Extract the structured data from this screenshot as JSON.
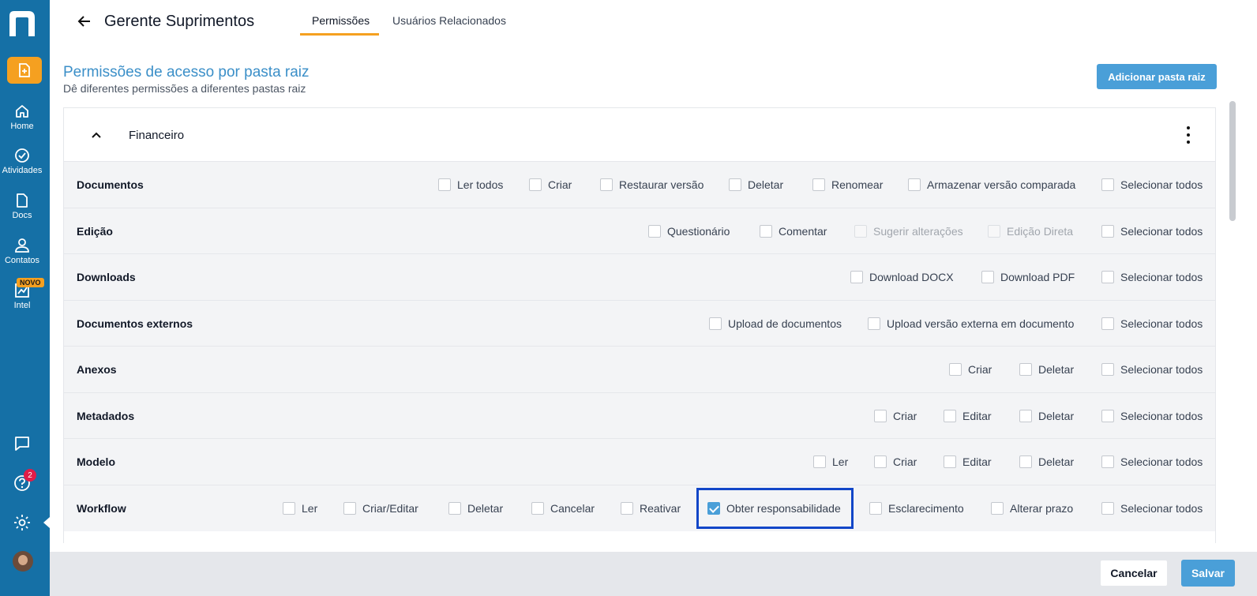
{
  "sidebar": {
    "items": [
      {
        "label": "Home"
      },
      {
        "label": "Atividades"
      },
      {
        "label": "Docs"
      },
      {
        "label": "Contatos"
      },
      {
        "label": "Intel",
        "badge": "NOVO"
      }
    ],
    "help_badge": "2"
  },
  "header": {
    "title": "Gerente Suprimentos",
    "tabs": [
      {
        "label": "Permissões",
        "active": true
      },
      {
        "label": "Usuários Relacionados",
        "active": false
      }
    ]
  },
  "section": {
    "title": "Permissões de acesso por pasta raiz",
    "subtitle": "Dê diferentes permissões a diferentes pastas raiz",
    "add_button": "Adicionar pasta raiz"
  },
  "folder": {
    "name": "Financeiro",
    "rows": [
      {
        "label": "Documentos",
        "options": [
          {
            "label": "Ler todos",
            "checked": false,
            "disabled": false
          },
          {
            "label": "Criar",
            "checked": false,
            "disabled": false
          },
          {
            "label": "Restaurar versão",
            "checked": false,
            "disabled": false
          },
          {
            "label": "Deletar",
            "checked": false,
            "disabled": false
          },
          {
            "label": "Renomear",
            "checked": false,
            "disabled": false
          },
          {
            "label": "Armazenar versão comparada",
            "checked": false,
            "disabled": false
          },
          {
            "label": "Selecionar todos",
            "checked": false,
            "disabled": false
          }
        ]
      },
      {
        "label": "Edição",
        "options": [
          {
            "label": "Questionário",
            "checked": false,
            "disabled": false
          },
          {
            "label": "Comentar",
            "checked": false,
            "disabled": false
          },
          {
            "label": "Sugerir alterações",
            "checked": false,
            "disabled": true
          },
          {
            "label": "Edição Direta",
            "checked": false,
            "disabled": true
          },
          {
            "label": "Selecionar todos",
            "checked": false,
            "disabled": false
          }
        ]
      },
      {
        "label": "Downloads",
        "options": [
          {
            "label": "Download DOCX",
            "checked": false,
            "disabled": false
          },
          {
            "label": "Download PDF",
            "checked": false,
            "disabled": false
          },
          {
            "label": "Selecionar todos",
            "checked": false,
            "disabled": false
          }
        ]
      },
      {
        "label": "Documentos externos",
        "options": [
          {
            "label": "Upload de documentos",
            "checked": false,
            "disabled": false
          },
          {
            "label": "Upload versão externa em documento",
            "checked": false,
            "disabled": false
          },
          {
            "label": "Selecionar todos",
            "checked": false,
            "disabled": false
          }
        ]
      },
      {
        "label": "Anexos",
        "options": [
          {
            "label": "Criar",
            "checked": false,
            "disabled": false
          },
          {
            "label": "Deletar",
            "checked": false,
            "disabled": false
          },
          {
            "label": "Selecionar todos",
            "checked": false,
            "disabled": false
          }
        ]
      },
      {
        "label": "Metadados",
        "options": [
          {
            "label": "Criar",
            "checked": false,
            "disabled": false
          },
          {
            "label": "Editar",
            "checked": false,
            "disabled": false
          },
          {
            "label": "Deletar",
            "checked": false,
            "disabled": false
          },
          {
            "label": "Selecionar todos",
            "checked": false,
            "disabled": false
          }
        ]
      },
      {
        "label": "Modelo",
        "options": [
          {
            "label": "Ler",
            "checked": false,
            "disabled": false
          },
          {
            "label": "Criar",
            "checked": false,
            "disabled": false
          },
          {
            "label": "Editar",
            "checked": false,
            "disabled": false
          },
          {
            "label": "Deletar",
            "checked": false,
            "disabled": false
          },
          {
            "label": "Selecionar todos",
            "checked": false,
            "disabled": false
          }
        ]
      },
      {
        "label": "Workflow",
        "options": [
          {
            "label": "Ler",
            "checked": false,
            "disabled": false
          },
          {
            "label": "Criar/Editar",
            "checked": false,
            "disabled": false
          },
          {
            "label": "Deletar",
            "checked": false,
            "disabled": false
          },
          {
            "label": "Cancelar",
            "checked": false,
            "disabled": false
          },
          {
            "label": "Reativar",
            "checked": false,
            "disabled": false
          },
          {
            "label": "Obter responsabilidade",
            "checked": true,
            "disabled": false
          },
          {
            "label": "Esclarecimento",
            "checked": false,
            "disabled": false
          },
          {
            "label": "Alterar prazo",
            "checked": false,
            "disabled": false
          },
          {
            "label": "Selecionar todos",
            "checked": false,
            "disabled": false
          }
        ]
      }
    ]
  },
  "footer": {
    "cancel_label": "Cancelar",
    "save_label": "Salvar"
  },
  "colors": {
    "sidebar": "#1570a6",
    "accent": "#f5a020",
    "primary": "#4a9fd8",
    "title": "#3b8fc8",
    "highlight": "#1246c8"
  }
}
